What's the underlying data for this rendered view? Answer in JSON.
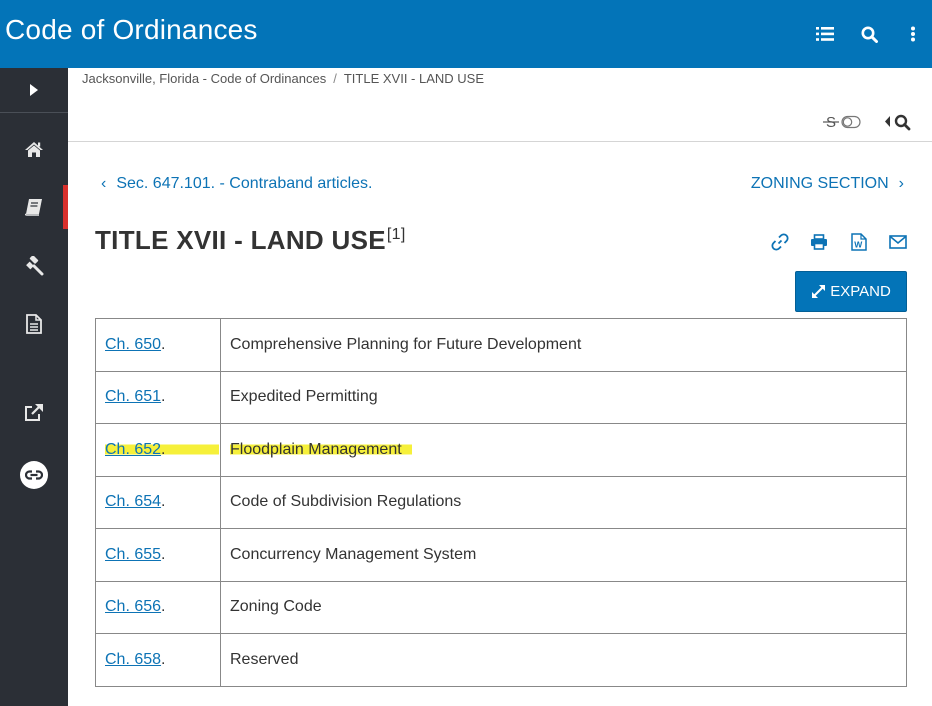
{
  "app": {
    "title": "Code of Ordinances"
  },
  "breadcrumb": [
    "Jacksonville, Florida - Code of Ordinances",
    "TITLE XVII - LAND USE"
  ],
  "breadcrumb_separator": "/",
  "navigation": {
    "prev_label": "Sec. 647.101. - Contraband articles.",
    "next_label": "ZONING SECTION"
  },
  "page": {
    "title": "TITLE XVII - LAND USE",
    "footnote_ref": "[1]"
  },
  "expand_label": "EXPAND",
  "chapters": [
    {
      "ch": "Ch. 650",
      "title": "Comprehensive Planning for Future Development",
      "highlighted": false
    },
    {
      "ch": "Ch. 651",
      "title": "Expedited Permitting",
      "highlighted": false
    },
    {
      "ch": "Ch. 652",
      "title": "Floodplain Management",
      "highlighted": true
    },
    {
      "ch": "Ch. 654",
      "title": "Code of Subdivision Regulations",
      "highlighted": false
    },
    {
      "ch": "Ch. 655",
      "title": "Concurrency Management System",
      "highlighted": false
    },
    {
      "ch": "Ch. 656",
      "title": "Zoning Code",
      "highlighted": false
    },
    {
      "ch": "Ch. 658",
      "title": "Reserved",
      "highlighted": false
    }
  ],
  "icons": {
    "header": [
      "list-icon",
      "search-icon",
      "more-vertical-icon"
    ],
    "sidebar": [
      "expand-arrow-icon",
      "home-icon",
      "book-icon",
      "gavel-icon",
      "document-icon",
      "external-link-icon",
      "link-circle-icon"
    ],
    "actions": [
      "link-icon",
      "print-icon",
      "word-icon",
      "email-icon"
    ]
  },
  "colors": {
    "brand": "#0374b8",
    "sidebar": "#2b2f36",
    "active_marker": "#d9302c",
    "link": "#0d73b5",
    "highlight": "#f6f03a"
  }
}
